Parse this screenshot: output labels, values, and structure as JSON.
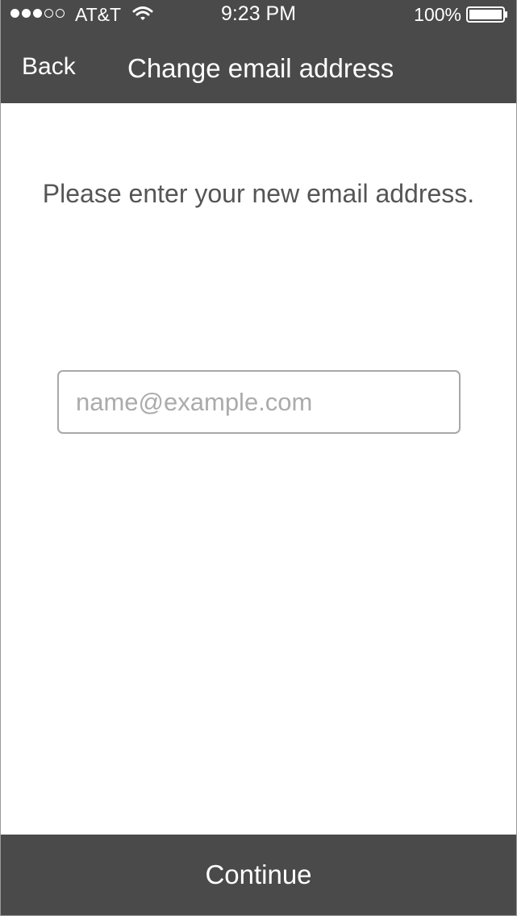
{
  "status_bar": {
    "carrier": "AT&T",
    "time": "9:23 PM",
    "battery_percent": "100%",
    "signal_bars_filled": 3,
    "signal_bars_total": 5,
    "icons": [
      "signal-dots-icon",
      "wifi-icon",
      "battery-icon"
    ]
  },
  "nav": {
    "back_label": "Back",
    "title": "Change email address"
  },
  "main": {
    "instruction": "Please enter your new email address.",
    "email_input": {
      "value": "",
      "placeholder": "name@example.com"
    }
  },
  "footer": {
    "continue_label": "Continue"
  },
  "colors": {
    "bar_background": "#4a4a4a",
    "bar_text": "#ffffff",
    "body_text": "#555555",
    "input_border": "#a8a8a8",
    "placeholder": "#ababab"
  }
}
